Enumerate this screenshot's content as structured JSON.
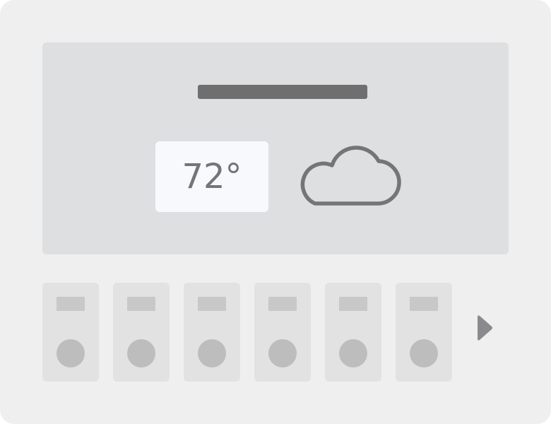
{
  "weather": {
    "temperature": "72°",
    "condition_icon": "cloud-icon"
  },
  "forecast": {
    "card_count": 6,
    "next_icon": "chevron-right-icon"
  },
  "colors": {
    "background": "#efefef",
    "hero_panel": "#dedfe1",
    "title_placeholder": "#6f6f6f",
    "temp_box": "#f8f9fc",
    "temp_text": "#757575",
    "cloud_outline": "#757575",
    "card": "#e2e2e2",
    "card_label": "#c8c8c8",
    "card_circle": "#bdbdbd",
    "arrow": "#8a8a8e"
  }
}
